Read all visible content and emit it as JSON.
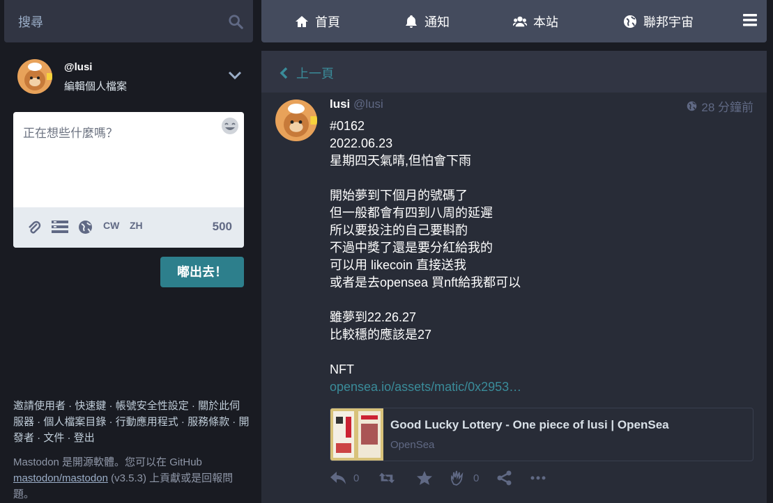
{
  "search": {
    "placeholder": "搜尋"
  },
  "profile": {
    "acct": "@lusi",
    "edit_label": "編輯個人檔案"
  },
  "compose": {
    "placeholder": "正在想些什麼嗎？",
    "cw_label": "CW",
    "lang_label": "ZH",
    "char_count": "500",
    "submit_label": "嘟出去！"
  },
  "nav": {
    "items": [
      {
        "label": "首頁",
        "icon": "home-icon"
      },
      {
        "label": "通知",
        "icon": "bell-icon"
      },
      {
        "label": "本站",
        "icon": "users-icon"
      },
      {
        "label": "聯邦宇宙",
        "icon": "globe-icon"
      }
    ],
    "menu_icon": "hamburger-icon"
  },
  "back": {
    "label": "上一頁"
  },
  "post": {
    "display_name": "lusi",
    "handle": "@lusi",
    "time": "28 分鐘前",
    "paragraphs": [
      [
        "#0162",
        "2022.06.23",
        "星期四天氣晴,但怕會下雨"
      ],
      [
        "開始夢到下個月的號碼了",
        "但一般都會有四到八周的延遲",
        "所以要投注的自己要斟酌",
        "不過中獎了還是要分紅給我的",
        "可以用 likecoin 直接送我",
        "或者是去opensea 買nft給我都可以"
      ],
      [
        "雖夢到22.26.27",
        "比較穩的應該是27"
      ]
    ],
    "nft_label": "NFT",
    "link_text": "opensea.io/assets/matic/0x2953…",
    "card": {
      "title": "Good Lucky Lottery - One piece of lusi | OpenSea",
      "site": "OpenSea"
    },
    "actions": {
      "reply_count": "0",
      "emoji_count": "0"
    }
  },
  "footer": {
    "links": [
      "邀請使用者",
      "快速鍵",
      "帳號安全性設定",
      "關於此伺服器",
      "個人檔案目錄",
      "行動應用程式",
      "服務條款",
      "開發者",
      "文件",
      "登出"
    ],
    "about_prefix": "Mastodon 是開源軟體。您可以在 GitHub",
    "about_repo": "mastodon/mastodon",
    "about_suffix": "(v3.5.3) 上貢獻或是回報問題。"
  },
  "colors": {
    "accent": "#2d7f8c",
    "bg": "#191b22",
    "panel": "#282c37"
  }
}
